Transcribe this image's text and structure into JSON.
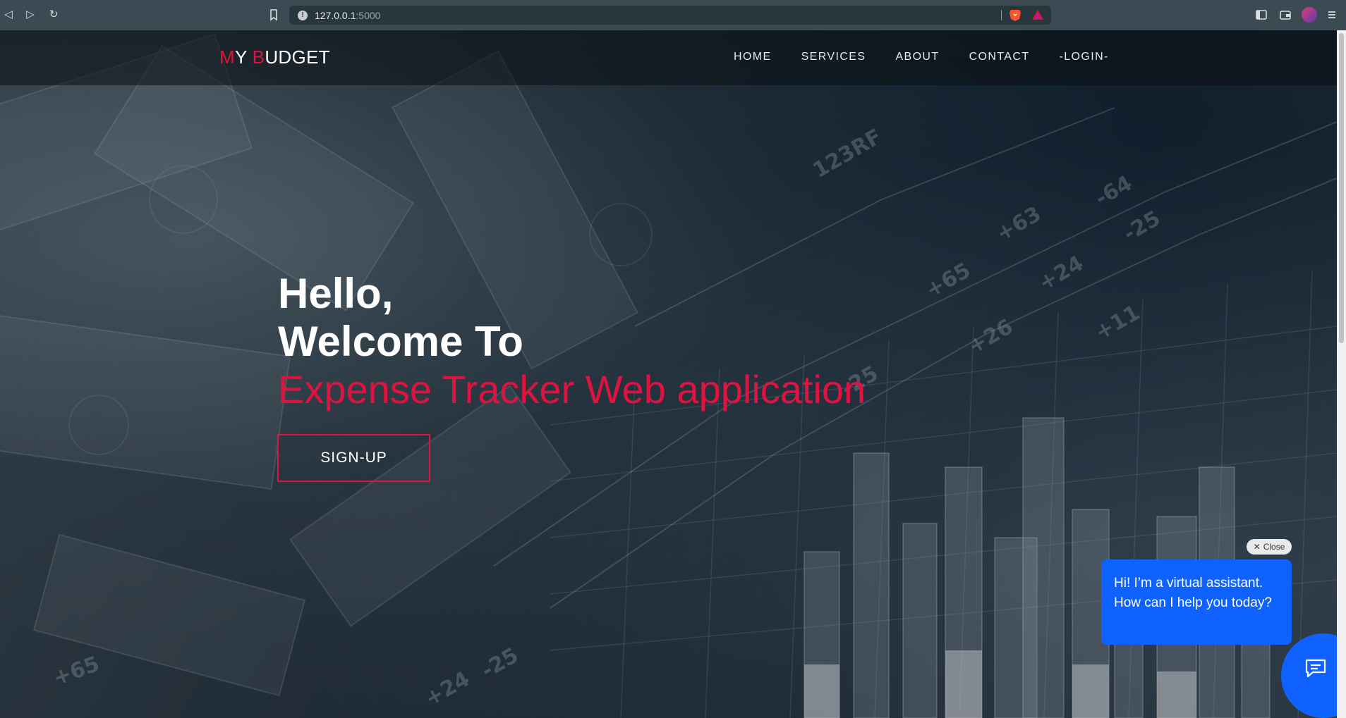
{
  "browser": {
    "url_host": "127.0.0.1",
    "url_port": ":5000"
  },
  "site": {
    "logo": {
      "first_accent": "M",
      "first_rest": "Y ",
      "second_accent": "B",
      "second_rest": "UDGET"
    },
    "nav": [
      {
        "label": "HOME"
      },
      {
        "label": "SERVICES"
      },
      {
        "label": "ABOUT"
      },
      {
        "label": "CONTACT"
      },
      {
        "label": "-LOGIN-"
      }
    ]
  },
  "hero": {
    "line1": "Hello,",
    "line2": "Welcome To",
    "line3": "Expense Tracker Web application",
    "cta": "SIGN-UP"
  },
  "chat": {
    "close_label": "Close",
    "message": "Hi! I’m a virtual assistant. How can I help you today?"
  },
  "colors": {
    "accent": "#e0123f",
    "chat_blue": "#0f62fe"
  }
}
